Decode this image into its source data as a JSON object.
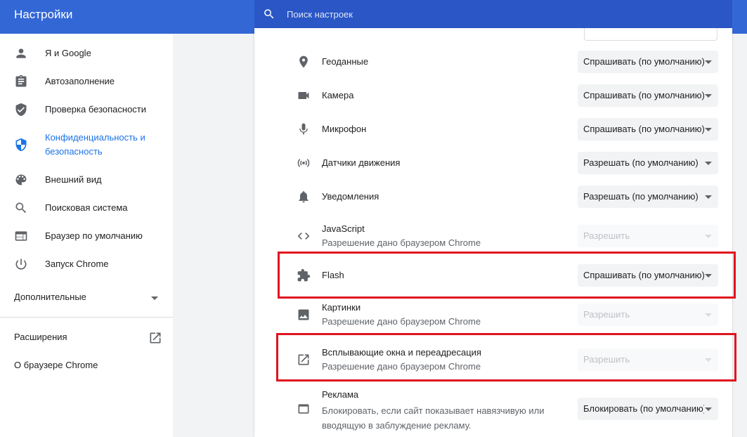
{
  "header": {
    "title": "Настройки",
    "search_placeholder": "Поиск настроек"
  },
  "sidebar": {
    "items": [
      {
        "label": "Я и Google",
        "icon": "person-icon"
      },
      {
        "label": "Автозаполнение",
        "icon": "clipboard-icon"
      },
      {
        "label": "Проверка безопасности",
        "icon": "shield-check-icon"
      },
      {
        "label": "Конфиденциальность и\nбезопасность",
        "icon": "shield-icon",
        "active": true
      },
      {
        "label": "Внешний вид",
        "icon": "palette-icon"
      },
      {
        "label": "Поисковая система",
        "icon": "search-icon"
      },
      {
        "label": "Браузер по умолчанию",
        "icon": "browser-icon"
      },
      {
        "label": "Запуск Chrome",
        "icon": "power-icon"
      }
    ],
    "advanced_label": "Дополнительные",
    "extensions_label": "Расширения",
    "about_label": "О браузере Chrome"
  },
  "settings": {
    "rows": [
      {
        "title": "Геоданные",
        "subtitle": "",
        "value": "Спрашивать (по умолчанию)",
        "disabled": false,
        "icon": "location-icon"
      },
      {
        "title": "Камера",
        "subtitle": "",
        "value": "Спрашивать (по умолчанию)",
        "disabled": false,
        "icon": "camera-icon"
      },
      {
        "title": "Микрофон",
        "subtitle": "",
        "value": "Спрашивать (по умолчанию)",
        "disabled": false,
        "icon": "microphone-icon"
      },
      {
        "title": "Датчики движения",
        "subtitle": "",
        "value": "Разрешать (по умолчанию)",
        "disabled": false,
        "icon": "sensors-icon"
      },
      {
        "title": "Уведомления",
        "subtitle": "",
        "value": "Разрешать (по умолчанию)",
        "disabled": false,
        "icon": "bell-icon"
      },
      {
        "title": "JavaScript",
        "subtitle": "Разрешение дано браузером Chrome",
        "value": "Разрешить",
        "disabled": true,
        "icon": "code-icon"
      },
      {
        "title": "Flash",
        "subtitle": "",
        "value": "Спрашивать (по умолчанию)",
        "disabled": false,
        "icon": "puzzle-icon"
      },
      {
        "title": "Картинки",
        "subtitle": "Разрешение дано браузером Chrome",
        "value": "Разрешить",
        "disabled": true,
        "icon": "image-icon"
      },
      {
        "title": "Всплывающие окна и переадресация",
        "subtitle": "Разрешение дано браузером Chrome",
        "value": "Разрешить",
        "disabled": true,
        "icon": "open-in-new-icon"
      },
      {
        "title": "Реклама",
        "subtitle": "Блокировать, если сайт показывает навязчивую или\nвводящую в заблуждение рекламу.",
        "value": "Блокировать (по умолчанию)",
        "disabled": false,
        "icon": "ads-icon"
      }
    ]
  },
  "colors": {
    "header": "#3367d6",
    "accent": "#1a73e8",
    "highlight": "#e0141e"
  }
}
